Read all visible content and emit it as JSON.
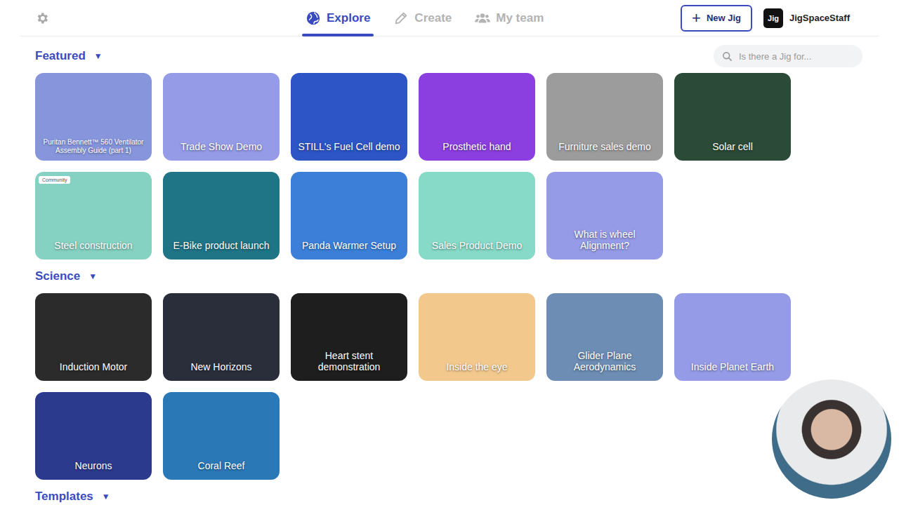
{
  "topbar": {
    "tabs": [
      {
        "label": "Explore",
        "selected": true
      },
      {
        "label": "Create",
        "selected": false
      },
      {
        "label": "My team",
        "selected": false
      }
    ],
    "new_button": {
      "icon": "+",
      "label": "New Jig"
    },
    "user": {
      "logo": "Jig",
      "name": "JigSpaceStaff"
    }
  },
  "search": {
    "placeholder": "Is there a Jig for..."
  },
  "sections": [
    {
      "title": "Featured",
      "toggle": "▼",
      "expanded": true,
      "cards": [
        {
          "label": "Puritan Bennett™ 560 Ventilator Assembly Guide (part 1)",
          "color": "#8796dc",
          "badge": ""
        },
        {
          "label": "Trade Show Demo",
          "color": "#959be6",
          "badge": ""
        },
        {
          "label": "STILL's Fuel Cell demo",
          "color": "#2d55c6",
          "badge": ""
        },
        {
          "label": "Prosthetic hand",
          "color": "#8b3fe0",
          "badge": ""
        },
        {
          "label": "Furniture sales demo",
          "color": "#9c9c9c",
          "badge": ""
        },
        {
          "label": "Solar cell",
          "color": "#2c4a38",
          "badge": ""
        },
        {
          "label": "Steel construction",
          "color": "#86d2c2",
          "badge": "Community"
        },
        {
          "label": "E-Bike product launch",
          "color": "#1f7486",
          "badge": ""
        },
        {
          "label": "Panda Warmer Setup",
          "color": "#3b7fd9",
          "badge": ""
        },
        {
          "label": "Sales Product Demo",
          "color": "#86dac7",
          "badge": ""
        },
        {
          "label": "What is wheel Alignment?",
          "color": "#959be6",
          "badge": ""
        }
      ]
    },
    {
      "title": "Science",
      "toggle": "▼",
      "expanded": true,
      "cards": [
        {
          "label": "Induction Motor",
          "color": "#2b2b2b",
          "badge": ""
        },
        {
          "label": "New Horizons",
          "color": "#2a2e3a",
          "badge": ""
        },
        {
          "label": "Heart stent demonstration",
          "color": "#1e1e1e",
          "badge": ""
        },
        {
          "label": "Inside the eye",
          "color": "#f3c88c",
          "badge": ""
        },
        {
          "label": "Glider Plane Aerodynamics",
          "color": "#6d8db4",
          "badge": ""
        },
        {
          "label": "Inside Planet Earth",
          "color": "#959be6",
          "badge": ""
        },
        {
          "label": "Neurons",
          "color": "#2b3a8c",
          "badge": ""
        },
        {
          "label": "Coral Reef",
          "color": "#2a78b6",
          "badge": ""
        }
      ]
    },
    {
      "title": "Templates",
      "toggle": "▼",
      "expanded": true,
      "cards": []
    }
  ]
}
